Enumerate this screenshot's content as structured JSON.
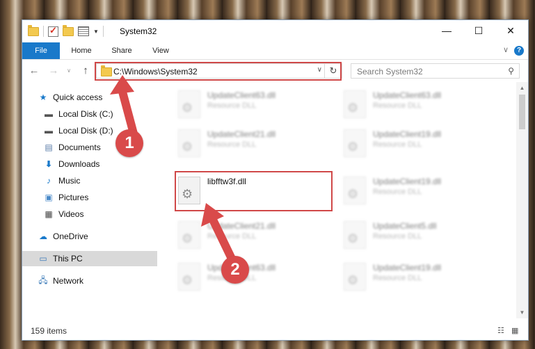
{
  "window": {
    "title": "System32"
  },
  "ribbon": {
    "tabs": [
      {
        "label": "File"
      },
      {
        "label": "Home"
      },
      {
        "label": "Share"
      },
      {
        "label": "View"
      }
    ]
  },
  "address": {
    "path": "C:\\Windows\\System32"
  },
  "search": {
    "placeholder": "Search System32"
  },
  "sidebar": {
    "items": [
      {
        "label": "Quick access",
        "icon": "star-icon"
      },
      {
        "label": "Local Disk (C:)",
        "icon": "drive-icon"
      },
      {
        "label": "Local Disk (D:)",
        "icon": "drive-icon"
      },
      {
        "label": "Documents",
        "icon": "documents-icon"
      },
      {
        "label": "Downloads",
        "icon": "download-icon"
      },
      {
        "label": "Music",
        "icon": "music-icon"
      },
      {
        "label": "Pictures",
        "icon": "pictures-icon"
      },
      {
        "label": "Videos",
        "icon": "videos-icon"
      },
      {
        "label": "OneDrive",
        "icon": "cloud-icon"
      },
      {
        "label": "This PC",
        "icon": "computer-icon"
      },
      {
        "label": "Network",
        "icon": "network-icon"
      }
    ]
  },
  "files": [
    {
      "name": "UpdateClient63.dll",
      "type": "Resource DLL"
    },
    {
      "name": "UpdateClient63.dll",
      "type": "Resource DLL"
    },
    {
      "name": "UpdateClient21.dll",
      "type": "Resource DLL"
    },
    {
      "name": "UpdateClient19.dll",
      "type": "Resource DLL"
    },
    {
      "name": "libfftw3f.dll",
      "type": ""
    },
    {
      "name": "UpdateClient19.dll",
      "type": "Resource DLL"
    },
    {
      "name": "UpdateClient21.dll",
      "type": "Resource DLL"
    },
    {
      "name": "UpdateClient5.dll",
      "type": "Resource DLL"
    },
    {
      "name": "UpdateClient63.dll",
      "type": "Resource DLL"
    },
    {
      "name": "UpdateClient19.dll",
      "type": "Resource DLL"
    }
  ],
  "status": {
    "count": "159 items"
  },
  "annotations": {
    "step1": "1",
    "step2": "2",
    "color": "#d94a4a"
  }
}
